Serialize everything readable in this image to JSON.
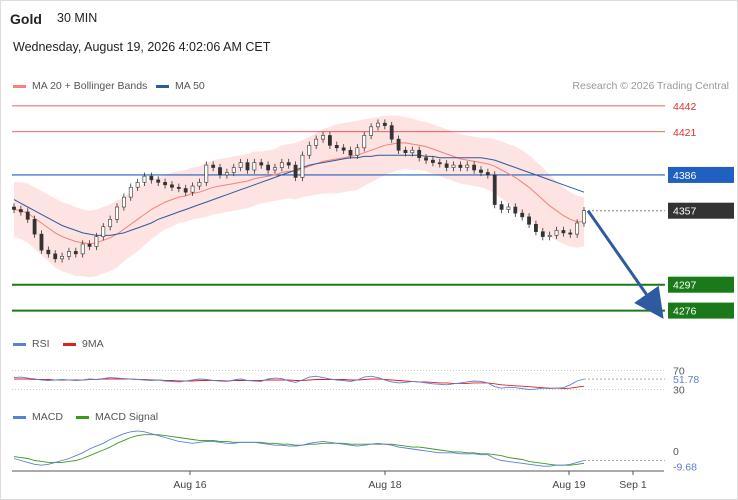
{
  "header": {
    "title": "Gold",
    "timeframe": "30 MIN",
    "datetime": "Wednesday, August 19, 2026 4:02:06 AM CET"
  },
  "credit": "Research © 2026 Trading Central",
  "legend_main": {
    "ma20": {
      "label": "MA 20 + Bollinger Bands",
      "color": "#f4827a"
    },
    "ma50": {
      "label": "MA 50",
      "color": "#2d5aa0"
    }
  },
  "legend_rsi": {
    "rsi": {
      "label": "RSI",
      "color": "#5b7fd6"
    },
    "ma": {
      "label": "9MA",
      "color": "#e02020"
    }
  },
  "legend_macd": {
    "macd": {
      "label": "MACD",
      "color": "#5b7fd6"
    },
    "signal": {
      "label": "MACD Signal",
      "color": "#3a9a1a"
    }
  },
  "chart_data": {
    "type": "candlestick",
    "instrument": "Gold",
    "timeframe": "30 MIN",
    "x_tick_labels": [
      "Aug 16",
      "Aug 18",
      "Aug 19",
      "Sep 1"
    ],
    "price_range": [
      4270,
      4450
    ],
    "levels": [
      {
        "label": "4442",
        "value": 4442,
        "kind": "resistance",
        "color": "#e03030"
      },
      {
        "label": "4421",
        "value": 4421,
        "kind": "resistance",
        "color": "#e03030"
      },
      {
        "label": "4386",
        "value": 4386,
        "kind": "pivot",
        "color": "#2060c0"
      },
      {
        "label": "4357",
        "value": 4357,
        "kind": "last_price",
        "color": "#333333"
      },
      {
        "label": "4297",
        "value": 4297,
        "kind": "support",
        "color": "#1a7a1a"
      },
      {
        "label": "4276",
        "value": 4276,
        "kind": "support",
        "color": "#1a7a1a"
      }
    ],
    "forecast": {
      "from": 4357,
      "to": 4276,
      "direction": "down"
    },
    "closes": [
      4358,
      4356,
      4350,
      4338,
      4325,
      4322,
      4318,
      4320,
      4324,
      4322,
      4330,
      4328,
      4336,
      4344,
      4350,
      4360,
      4368,
      4376,
      4380,
      4385,
      4382,
      4380,
      4378,
      4376,
      4375,
      4372,
      4377,
      4380,
      4394,
      4392,
      4386,
      4388,
      4392,
      4396,
      4390,
      4396,
      4394,
      4390,
      4392,
      4396,
      4394,
      4384,
      4402,
      4410,
      4415,
      4418,
      4410,
      4408,
      4406,
      4402,
      4408,
      4418,
      4425,
      4428,
      4426,
      4415,
      4406,
      4404,
      4406,
      4400,
      4398,
      4396,
      4395,
      4392,
      4394,
      4392,
      4394,
      4390,
      4388,
      4386,
      4362,
      4358,
      4360,
      4355,
      4352,
      4346,
      4340,
      4336,
      4337,
      4341,
      4339,
      4338,
      4347,
      4357
    ],
    "ma20": [
      4358,
      4357,
      4355,
      4351,
      4347,
      4343,
      4339,
      4336,
      4334,
      4332,
      4331,
      4330,
      4331,
      4333,
      4335,
      4338,
      4342,
      4346,
      4350,
      4354,
      4358,
      4361,
      4364,
      4366,
      4368,
      4369,
      4371,
      4372,
      4374,
      4376,
      4377,
      4378,
      4379,
      4380,
      4381,
      4383,
      4384,
      4385,
      4386,
      4388,
      4389,
      4389,
      4391,
      4393,
      4395,
      4397,
      4398,
      4399,
      4400,
      4401,
      4402,
      4404,
      4406,
      4408,
      4410,
      4411,
      4412,
      4412,
      4411,
      4410,
      4409,
      4407,
      4405,
      4403,
      4401,
      4399,
      4398,
      4397,
      4396,
      4395,
      4393,
      4390,
      4387,
      4384,
      4380,
      4376,
      4371,
      4366,
      4361,
      4357,
      4353,
      4350,
      4348,
      4348
    ],
    "ma50": [
      4366,
      4363,
      4360,
      4357,
      4354,
      4351,
      4348,
      4345,
      4343,
      4341,
      4339,
      4338,
      4337,
      4337,
      4337,
      4338,
      4339,
      4341,
      4343,
      4345,
      4347,
      4350,
      4352,
      4354,
      4356,
      4358,
      4360,
      4362,
      4364,
      4366,
      4368,
      4370,
      4372,
      4374,
      4376,
      4378,
      4380,
      4382,
      4384,
      4386,
      4388,
      4390,
      4392,
      4394,
      4395,
      4396,
      4397,
      4398,
      4399,
      4400,
      4400,
      4401,
      4401,
      4402,
      4402,
      4402,
      4402,
      4402,
      4402,
      4402,
      4401,
      4401,
      4400,
      4400,
      4400,
      4400,
      4400,
      4400,
      4400,
      4399,
      4398,
      4396,
      4394,
      4392,
      4390,
      4388,
      4386,
      4384,
      4382,
      4380,
      4378,
      4376,
      4374,
      4372
    ],
    "bb_width": [
      22,
      23,
      24,
      25,
      26,
      27,
      28,
      28,
      28,
      28,
      27,
      27,
      27,
      27,
      27,
      27,
      26,
      26,
      26,
      25,
      24,
      23,
      22,
      22,
      21,
      21,
      21,
      21,
      22,
      22,
      22,
      22,
      22,
      22,
      22,
      22,
      21,
      21,
      21,
      22,
      22,
      23,
      23,
      24,
      25,
      26,
      27,
      28,
      28,
      28,
      28,
      27,
      26,
      25,
      24,
      23,
      22,
      21,
      21,
      20,
      20,
      20,
      20,
      20,
      20,
      20,
      20,
      20,
      20,
      21,
      22,
      23,
      24,
      25,
      26,
      26,
      26,
      26,
      25,
      24,
      23,
      22,
      21,
      20
    ],
    "rsi": {
      "range": [
        0,
        100
      ],
      "levels": [
        70,
        30
      ],
      "value_label": "51.78",
      "rsi": [
        55,
        56,
        54,
        52,
        50,
        49,
        50,
        51,
        50,
        49,
        50,
        52,
        51,
        53,
        55,
        54,
        53,
        52,
        51,
        50,
        49,
        50,
        48,
        47,
        46,
        48,
        50,
        52,
        51,
        49,
        48,
        47,
        50,
        52,
        49,
        48,
        47,
        52,
        54,
        53,
        48,
        45,
        50,
        56,
        58,
        55,
        52,
        50,
        49,
        47,
        50,
        56,
        58,
        55,
        50,
        46,
        44,
        45,
        47,
        46,
        44,
        42,
        41,
        40,
        42,
        44,
        46,
        48,
        47,
        44,
        36,
        33,
        35,
        34,
        32,
        30,
        31,
        33,
        32,
        33,
        34,
        40,
        48,
        52
      ],
      "ma": [
        52,
        52,
        52,
        51,
        51,
        51,
        50,
        50,
        50,
        50,
        50,
        51,
        51,
        52,
        52,
        52,
        52,
        52,
        51,
        51,
        50,
        50,
        49,
        49,
        48,
        48,
        48,
        49,
        49,
        49,
        49,
        48,
        49,
        49,
        49,
        49,
        49,
        50,
        50,
        50,
        50,
        49,
        49,
        50,
        51,
        51,
        51,
        51,
        51,
        50,
        50,
        51,
        52,
        52,
        51,
        50,
        49,
        48,
        47,
        46,
        46,
        45,
        44,
        44,
        43,
        43,
        43,
        44,
        44,
        44,
        42,
        40,
        39,
        38,
        37,
        36,
        35,
        34,
        33,
        33,
        32,
        33,
        35,
        37
      ]
    },
    "macd": {
      "zero_label": "0",
      "value_label": "-9.68",
      "macd": [
        -8,
        -10,
        -12,
        -14,
        -15,
        -14,
        -12,
        -10,
        -8,
        -5,
        -2,
        2,
        5,
        8,
        12,
        15,
        18,
        20,
        21,
        20,
        18,
        16,
        14,
        12,
        10,
        9,
        8,
        9,
        10,
        10,
        9,
        8,
        8,
        9,
        9,
        9,
        8,
        7,
        6,
        6,
        5,
        5,
        6,
        8,
        9,
        10,
        9,
        8,
        7,
        6,
        5,
        6,
        7,
        8,
        7,
        6,
        4,
        3,
        2,
        1,
        0,
        -1,
        -2,
        -2,
        -2,
        -3,
        -3,
        -3,
        -4,
        -4,
        -8,
        -10,
        -11,
        -12,
        -13,
        -14,
        -15,
        -16,
        -16,
        -15,
        -15,
        -14,
        -12,
        -10
      ],
      "signal": [
        -6,
        -7,
        -8,
        -10,
        -11,
        -12,
        -12,
        -12,
        -11,
        -10,
        -8,
        -5,
        -2,
        1,
        4,
        8,
        11,
        14,
        16,
        17,
        17,
        17,
        16,
        15,
        14,
        13,
        12,
        11,
        11,
        11,
        10,
        10,
        9,
        9,
        9,
        9,
        9,
        8,
        8,
        7,
        7,
        6,
        6,
        7,
        7,
        8,
        8,
        8,
        8,
        7,
        7,
        7,
        7,
        7,
        7,
        7,
        6,
        5,
        4,
        4,
        3,
        2,
        1,
        0,
        -1,
        -1,
        -2,
        -2,
        -3,
        -3,
        -4,
        -5,
        -7,
        -8,
        -9,
        -11,
        -12,
        -13,
        -14,
        -15,
        -15,
        -15,
        -14,
        -13
      ]
    }
  }
}
